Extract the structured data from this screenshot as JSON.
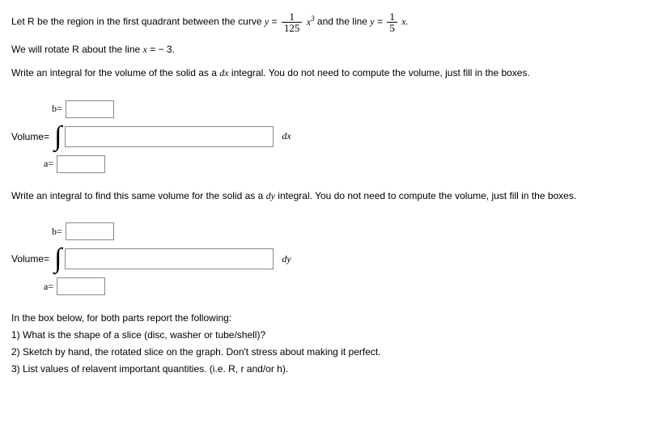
{
  "problem": {
    "intro_pre": "Let R be the region in the first quadrant between the curve ",
    "y_eq": "y",
    "eq_sign": " = ",
    "frac1_num": "1",
    "frac1_den": "125",
    "x_cubed_base": "x",
    "x_cubed_exp": "3",
    "and_line": " and the line ",
    "frac2_num": "1",
    "frac2_den": "5",
    "x_var": "x.",
    "rotate_line": "We will rotate R about the line ",
    "x_eq_val": "x",
    "neg3": " − 3.",
    "dx_instr1": "Write an integral for the volume of the solid as a ",
    "dx_sym": "dx",
    "dx_instr2": " integral. You do not need to compute the volume, just fill in the boxes.",
    "dy_instr1": "Write an integral to find this same volume for the solid as a ",
    "dy_sym": "dy",
    "dy_instr2": " integral. You do not need to compute the volume, just fill in the boxes."
  },
  "integral1": {
    "b_label": "b=",
    "b_value": "",
    "vol_label": "Volume",
    "equals": " = ",
    "integrand_value": "",
    "differential": "dx",
    "a_label": "a=",
    "a_value": ""
  },
  "integral2": {
    "b_label": "b=",
    "b_value": "",
    "vol_label": "Volume",
    "equals": " = ",
    "integrand_value": "",
    "differential": "dy",
    "a_label": "a=",
    "a_value": ""
  },
  "footer": {
    "l1": "In the box below, for both parts report the following:",
    "l2": "1) What is the shape of a slice (disc, washer or tube/shell)?",
    "l3": "2) Sketch by hand, the rotated slice on the graph. Don't stress about making it perfect.",
    "l4": "3) List values of relavent important quantities. (i.e. R, r and/or h)."
  }
}
